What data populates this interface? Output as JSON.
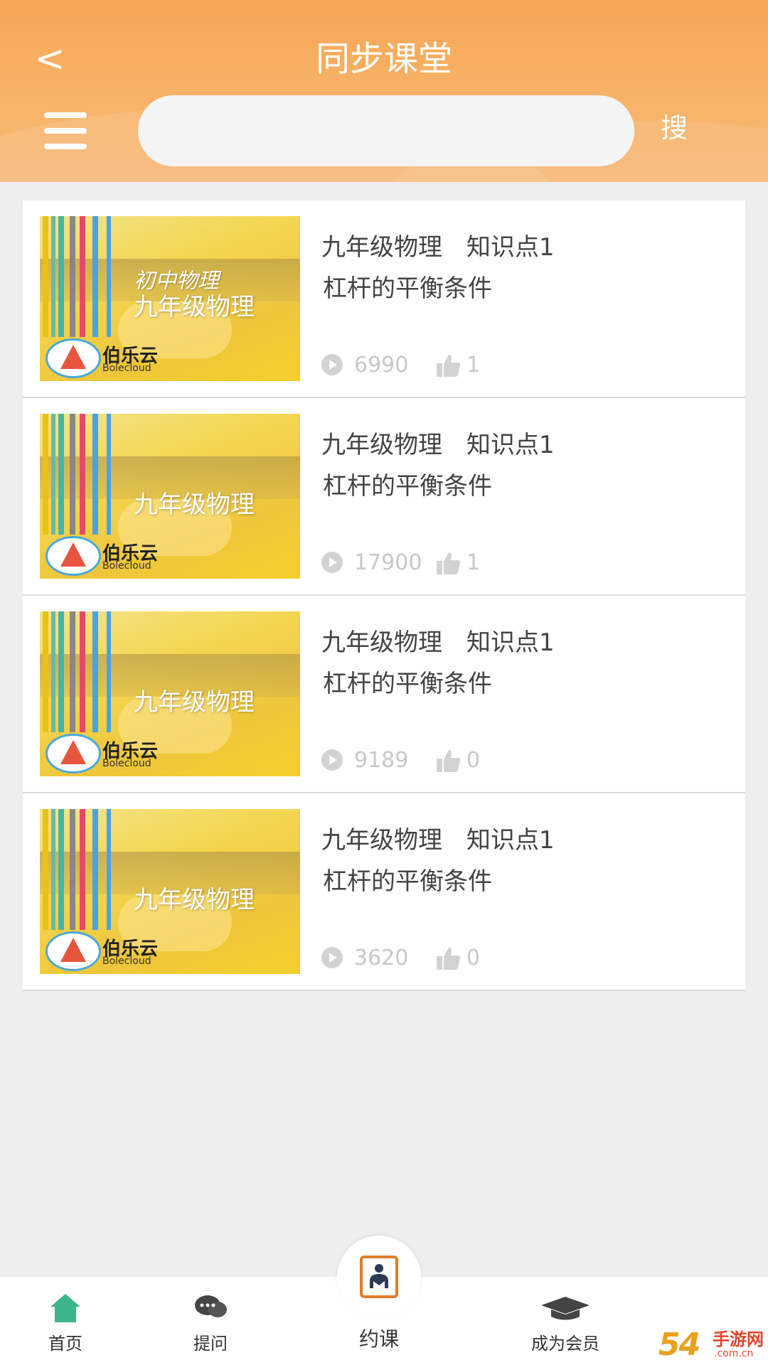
{
  "header": {
    "back_label": "<",
    "title": "同步课堂",
    "search_placeholder": "",
    "search_label": "搜"
  },
  "courses": [
    {
      "thumb_subtitle": "初中物理",
      "thumb_title": "九年级物理",
      "thumb_brand": "伯乐云",
      "thumb_brand_sub": "Bolecloud",
      "line1": "九年级物理　知识点1",
      "line2": "杠杆的平衡条件",
      "views": "6990",
      "likes": "1"
    },
    {
      "thumb_subtitle": "",
      "thumb_title": "九年级物理",
      "thumb_brand": "伯乐云",
      "thumb_brand_sub": "Bolecloud",
      "line1": "九年级物理　知识点1",
      "line2": "杠杆的平衡条件",
      "views": "17900",
      "likes": "1"
    },
    {
      "thumb_subtitle": "",
      "thumb_title": "九年级物理",
      "thumb_brand": "伯乐云",
      "thumb_brand_sub": "Bolecloud",
      "line1": "九年级物理　知识点1",
      "line2": "杠杆的平衡条件",
      "views": "9189",
      "likes": "0"
    },
    {
      "thumb_subtitle": "",
      "thumb_title": "九年级物理",
      "thumb_brand": "伯乐云",
      "thumb_brand_sub": "Bolecloud",
      "line1": "九年级物理　知识点1",
      "line2": "杠杆的平衡条件",
      "views": "3620",
      "likes": "0"
    }
  ],
  "tabbar": {
    "home": "首页",
    "ask": "提问",
    "book": "约课",
    "member": "成为会员"
  },
  "watermark": {
    "num": "54",
    "cn": "手游网",
    "url": ".com.cn"
  },
  "colors": {
    "header_orange": "#f6a654",
    "home_green": "#3db58a",
    "accent": "#e07d2a"
  }
}
